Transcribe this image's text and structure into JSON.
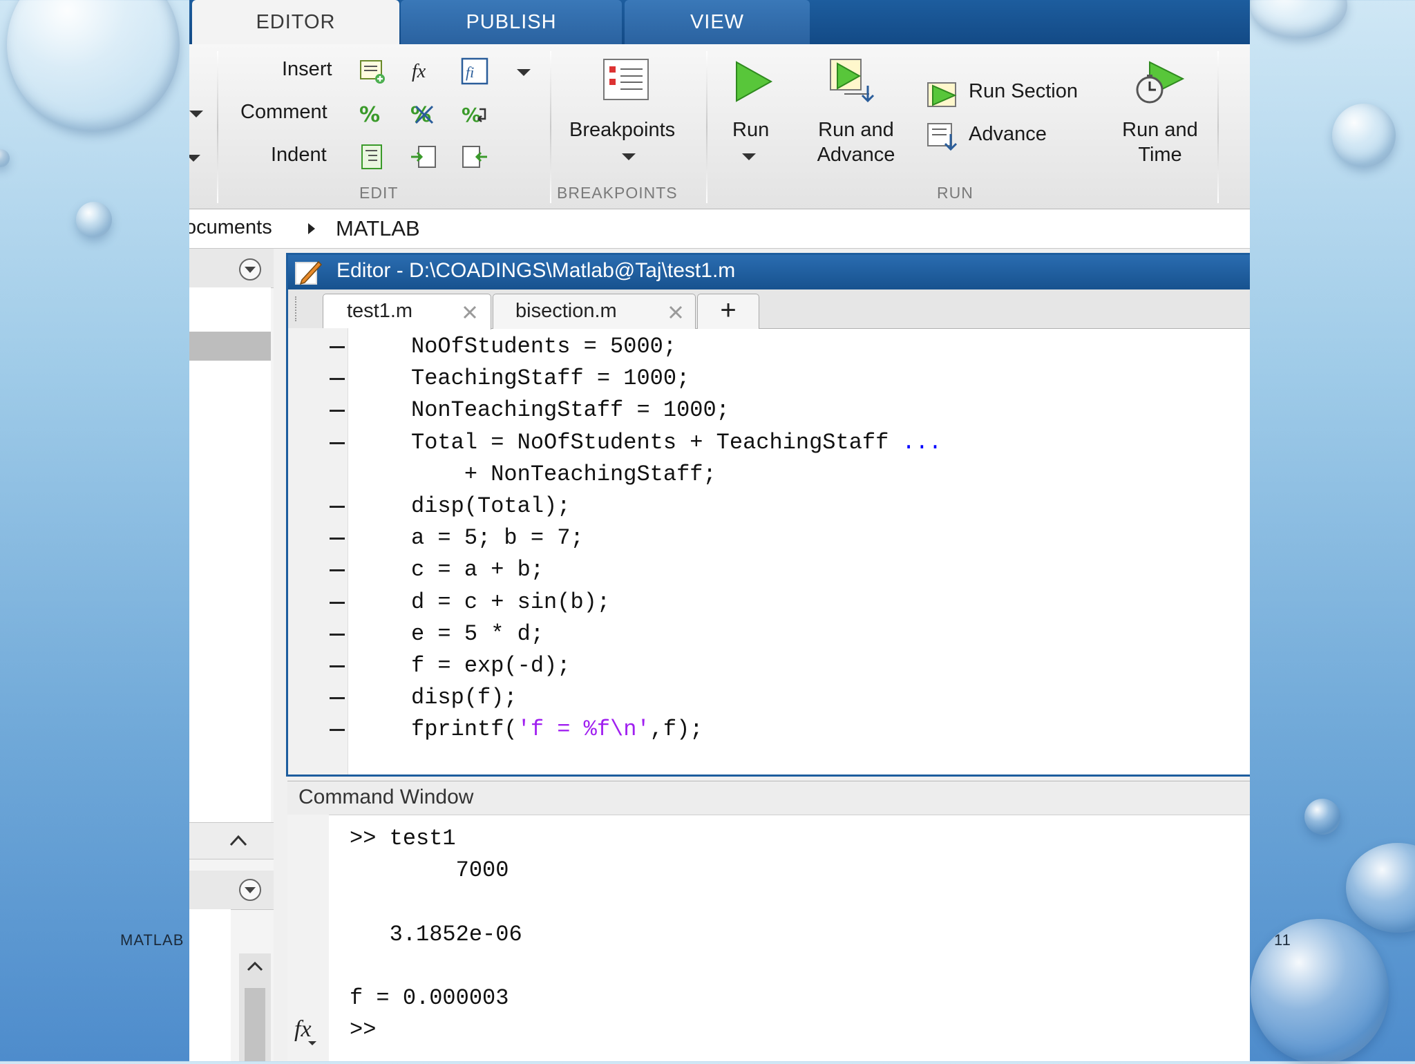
{
  "slide": {
    "footer_left": "MATLAB",
    "page_number": "11"
  },
  "ribbon": {
    "tabs": [
      "EDITOR",
      "PUBLISH",
      "VIEW"
    ],
    "active_tab": "EDITOR",
    "edit": {
      "insert_label": "Insert",
      "comment_label": "Comment",
      "indent_label": "Indent",
      "section_label": "EDIT"
    },
    "breakpoints": {
      "button_label": "Breakpoints",
      "section_label": "BREAKPOINTS"
    },
    "run": {
      "run_label": "Run",
      "run_advance_line1": "Run and",
      "run_advance_line2": "Advance",
      "run_section_label": "Run Section",
      "advance_label": "Advance",
      "run_time_line1": "Run and",
      "run_time_line2": "Time",
      "section_label": "RUN"
    }
  },
  "address_bar": {
    "crumbs": [
      "ocuments",
      "MATLAB"
    ]
  },
  "editor": {
    "title": "Editor - D:\\COADINGS\\Matlab@Taj\\test1.m",
    "tabs": [
      "test1.m",
      "bisection.m"
    ],
    "active_tab": "test1.m",
    "new_tab_label": "+",
    "lines": [
      {
        "text": "NoOfStudents = 5000;",
        "dash": true
      },
      {
        "text": "TeachingStaff = 1000;",
        "dash": true
      },
      {
        "text": "NonTeachingStaff = 1000;",
        "dash": true
      },
      {
        "text": "Total = NoOfStudents + TeachingStaff ",
        "cont": "...",
        "dash": true
      },
      {
        "text": "    + NonTeachingStaff;",
        "dash": false
      },
      {
        "text": "disp(Total);",
        "dash": true
      },
      {
        "text": "a = 5; b = 7;",
        "dash": true
      },
      {
        "text": "c = a + b;",
        "dash": true
      },
      {
        "text": "d = c + sin(b);",
        "dash": true
      },
      {
        "text": "e = 5 * d;",
        "dash": true
      },
      {
        "text": "f = exp(-d);",
        "dash": true
      },
      {
        "text": "disp(f);",
        "dash": true
      },
      {
        "pre": "fprintf(",
        "str": "'f = %f\\n'",
        "post": ",f);",
        "dash": true
      }
    ]
  },
  "command_window": {
    "title": "Command Window",
    "lines": [
      ">> test1",
      "        7000",
      "",
      "   3.1852e-06",
      "",
      "f = 0.000003",
      ">>"
    ],
    "fx_label": "fx"
  },
  "colors": {
    "title_blue": "#1d5d9e",
    "string_purple": "#a020f0",
    "continuation_blue": "#0000ff"
  }
}
